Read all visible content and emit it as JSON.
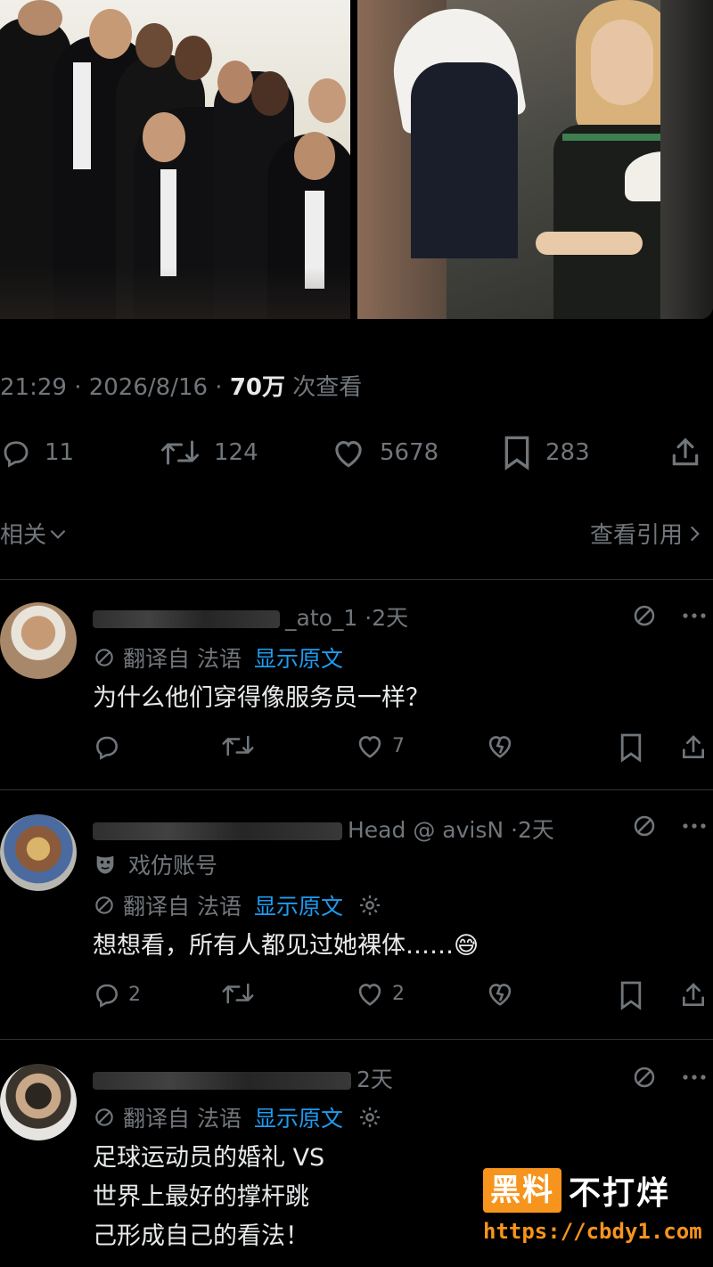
{
  "tweet": {
    "meta_time": "21:29 · 2026/8/16 · ",
    "meta_views": "70万",
    "meta_views_suffix": " 次查看",
    "stats": {
      "replies": "11",
      "reposts": "124",
      "likes": "5678",
      "bookmarks": "283"
    },
    "related_label": "相关",
    "view_quotes_label": "查看引用"
  },
  "replies": [
    {
      "handle_visible": "_ato_1 ·",
      "time": "2天",
      "translate_label": "翻译自 法语",
      "show_original": "显示原文",
      "text_lines": [
        "为什么他们穿得像服务员一样？"
      ],
      "stats": {
        "replies": "",
        "reposts": "",
        "likes": "7"
      }
    },
    {
      "handle_visible": "Head @    avisN  ·",
      "time": "2天",
      "parody_label": "戏仿账号",
      "translate_label": "翻译自 法语",
      "show_original": "显示原文",
      "text_lines": [
        "想想看，所有人都见过她裸体……😅"
      ],
      "stats": {
        "replies": "2",
        "reposts": "",
        "likes": "2"
      }
    },
    {
      "handle_visible": "",
      "time": "2天",
      "translate_label": "翻译自 法语",
      "show_original": "显示原文",
      "text_lines": [
        "足球运动员的婚礼 VS",
        "世界上最好的撑杆跳",
        "己形成自己的看法！"
      ]
    }
  ],
  "watermark": {
    "box_text": "黑料",
    "tail_text": "不打烊",
    "url": "https://cbdy1.com"
  },
  "colors": {
    "background": "#000000",
    "text": "#e7e9ea",
    "muted": "#71767b",
    "link": "#1d9bf0",
    "watermark_orange": "#f6941d"
  }
}
